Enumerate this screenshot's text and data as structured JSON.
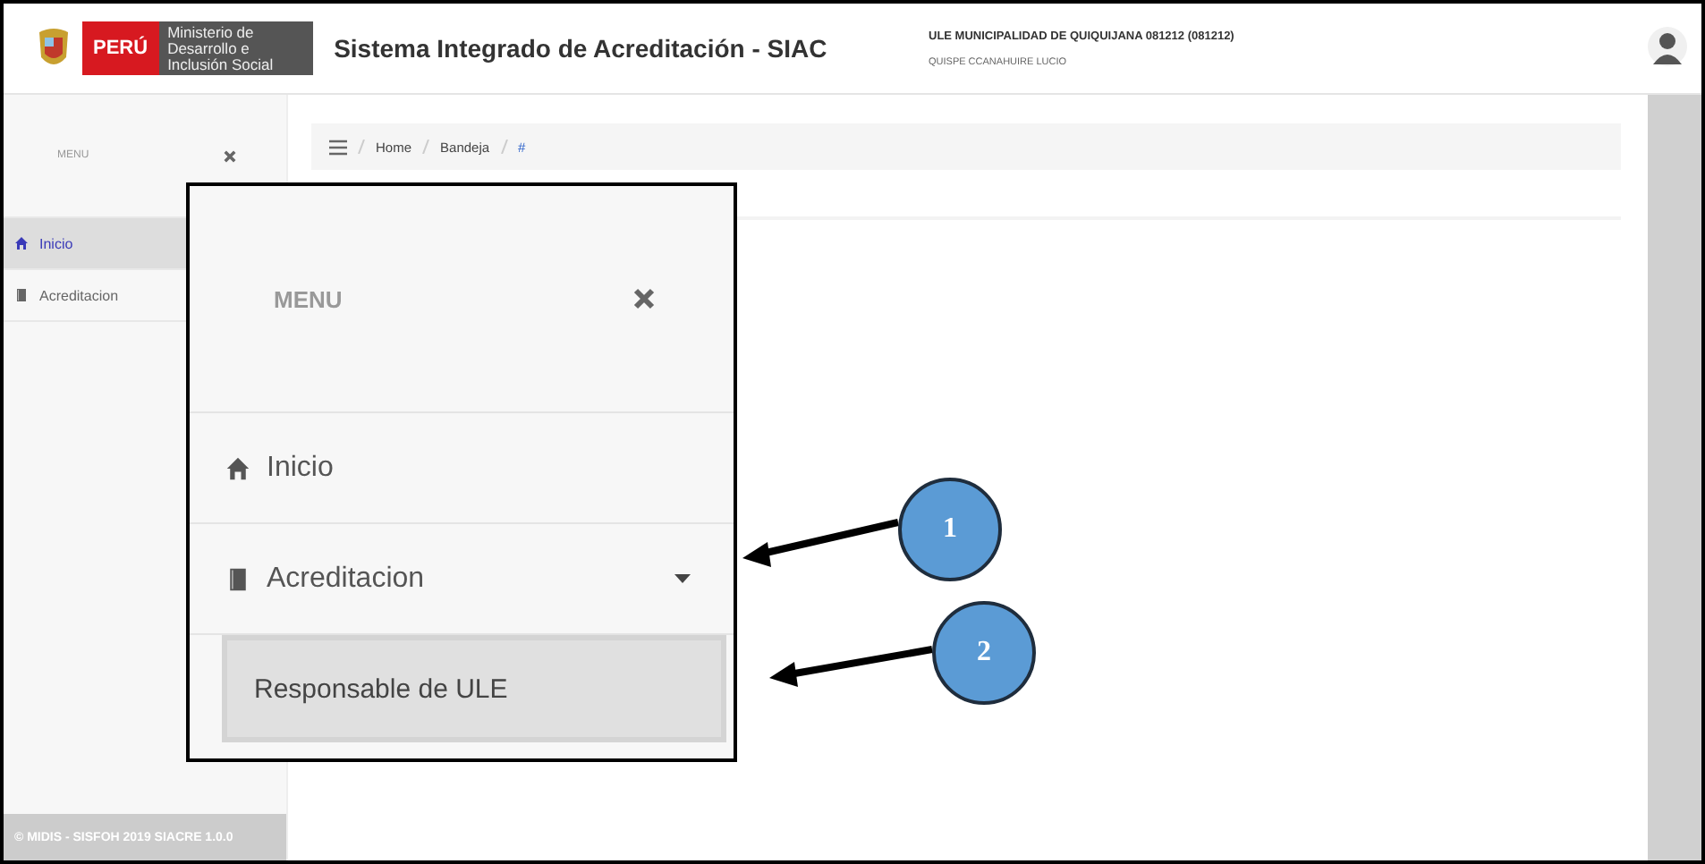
{
  "header": {
    "country": "PERÚ",
    "ministry": "Ministerio de Desarrollo e Inclusión Social",
    "title": "Sistema Integrado de Acreditación - SIAC",
    "organization": "ULE MUNICIPALIDAD DE QUIQUIJANA 081212 (081212)",
    "user": "QUISPE CCANAHUIRE LUCIO"
  },
  "sidebar": {
    "menu_label": "MENU",
    "items": [
      {
        "label": "Inicio",
        "kind": "link",
        "selected": true
      },
      {
        "label": "Acreditacion",
        "kind": "group",
        "selected": false
      }
    ],
    "footer": "© MIDIS - SISFOH 2019 SIACRE 1.0.0"
  },
  "breadcrumb": [
    "Home",
    "Bandeja",
    "#"
  ],
  "zoomed_menu": {
    "menu_label": "MENU",
    "items": [
      {
        "label": "Inicio",
        "kind": "link"
      },
      {
        "label": "Acreditacion",
        "kind": "group",
        "expanded": true,
        "children": [
          {
            "label": "Responsable de ULE",
            "selected": true
          }
        ]
      }
    ]
  },
  "callouts": [
    {
      "number": "1"
    },
    {
      "number": "2"
    }
  ]
}
